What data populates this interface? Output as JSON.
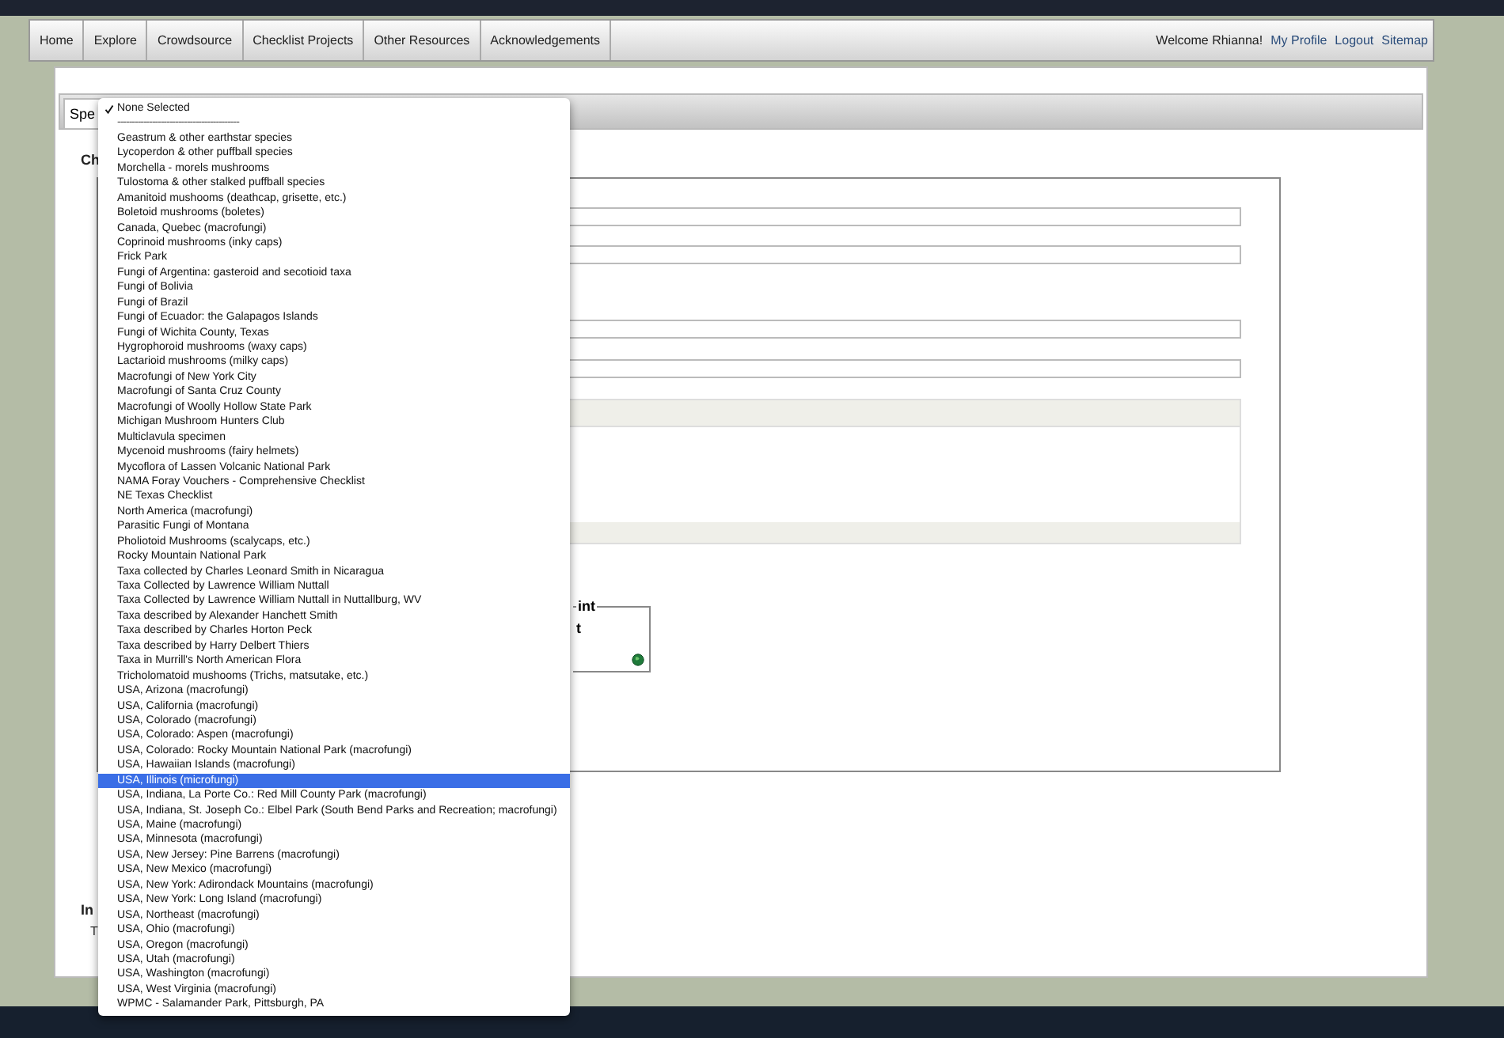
{
  "nav": {
    "links": [
      "Home",
      "Explore",
      "Crowdsource",
      "Checklist Projects",
      "Other Resources",
      "Acknowledgements"
    ],
    "welcome": "Welcome Rhianna!",
    "user_links": [
      "My Profile",
      "Logout",
      "Sitemap"
    ]
  },
  "tabs": [
    {
      "label": "Spe",
      "selected": true
    }
  ],
  "heading": "Ch",
  "footprint": {
    "legend": "int",
    "text": "t"
  },
  "section2": {
    "heading": "In",
    "text": "T"
  },
  "dropdown": {
    "options": [
      {
        "kind": "option",
        "label": "None Selected",
        "checked": true,
        "highlighted": false
      },
      {
        "kind": "separator",
        "label": "------------------------------------------"
      },
      {
        "kind": "option",
        "label": "Geastrum & other earthstar species",
        "checked": false,
        "highlighted": false
      },
      {
        "kind": "option",
        "label": "Lycoperdon & other puffball species",
        "checked": false,
        "highlighted": false
      },
      {
        "kind": "option",
        "label": "Morchella - morels mushrooms",
        "checked": false,
        "highlighted": false
      },
      {
        "kind": "option",
        "label": "Tulostoma & other stalked puffball species",
        "checked": false,
        "highlighted": false
      },
      {
        "kind": "option",
        "label": "Amanitoid mushooms (deathcap, grisette, etc.)",
        "checked": false,
        "highlighted": false
      },
      {
        "kind": "option",
        "label": "Boletoid mushrooms (boletes)",
        "checked": false,
        "highlighted": false
      },
      {
        "kind": "option",
        "label": "Canada, Quebec (macrofungi)",
        "checked": false,
        "highlighted": false
      },
      {
        "kind": "option",
        "label": "Coprinoid mushrooms (inky caps)",
        "checked": false,
        "highlighted": false
      },
      {
        "kind": "option",
        "label": "Frick Park",
        "checked": false,
        "highlighted": false
      },
      {
        "kind": "option",
        "label": "Fungi of Argentina: gasteroid and secotioid taxa",
        "checked": false,
        "highlighted": false
      },
      {
        "kind": "option",
        "label": "Fungi of Bolivia",
        "checked": false,
        "highlighted": false
      },
      {
        "kind": "option",
        "label": "Fungi of Brazil",
        "checked": false,
        "highlighted": false
      },
      {
        "kind": "option",
        "label": "Fungi of Ecuador: the Galapagos Islands",
        "checked": false,
        "highlighted": false
      },
      {
        "kind": "option",
        "label": "Fungi of Wichita County, Texas",
        "checked": false,
        "highlighted": false
      },
      {
        "kind": "option",
        "label": "Hygrophoroid mushrooms (waxy caps)",
        "checked": false,
        "highlighted": false
      },
      {
        "kind": "option",
        "label": "Lactarioid mushrooms (milky caps)",
        "checked": false,
        "highlighted": false
      },
      {
        "kind": "option",
        "label": "Macrofungi of New York City",
        "checked": false,
        "highlighted": false
      },
      {
        "kind": "option",
        "label": "Macrofungi of Santa Cruz County",
        "checked": false,
        "highlighted": false
      },
      {
        "kind": "option",
        "label": "Macrofungi of Woolly Hollow State Park",
        "checked": false,
        "highlighted": false
      },
      {
        "kind": "option",
        "label": "Michigan Mushroom Hunters Club",
        "checked": false,
        "highlighted": false
      },
      {
        "kind": "option",
        "label": "Multiclavula specimen",
        "checked": false,
        "highlighted": false
      },
      {
        "kind": "option",
        "label": "Mycenoid mushrooms (fairy helmets)",
        "checked": false,
        "highlighted": false
      },
      {
        "kind": "option",
        "label": "Mycoflora of Lassen Volcanic National Park",
        "checked": false,
        "highlighted": false
      },
      {
        "kind": "option",
        "label": "NAMA Foray Vouchers - Comprehensive Checklist",
        "checked": false,
        "highlighted": false
      },
      {
        "kind": "option",
        "label": "NE Texas Checklist",
        "checked": false,
        "highlighted": false
      },
      {
        "kind": "option",
        "label": "North America (macrofungi)",
        "checked": false,
        "highlighted": false
      },
      {
        "kind": "option",
        "label": "Parasitic Fungi of Montana",
        "checked": false,
        "highlighted": false
      },
      {
        "kind": "option",
        "label": "Pholiotoid Mushrooms (scalycaps, etc.)",
        "checked": false,
        "highlighted": false
      },
      {
        "kind": "option",
        "label": "Rocky Mountain National Park",
        "checked": false,
        "highlighted": false
      },
      {
        "kind": "option",
        "label": "Taxa collected by Charles Leonard Smith in Nicaragua",
        "checked": false,
        "highlighted": false
      },
      {
        "kind": "option",
        "label": "Taxa Collected by Lawrence William Nuttall",
        "checked": false,
        "highlighted": false
      },
      {
        "kind": "option",
        "label": "Taxa Collected by Lawrence William Nuttall in Nuttallburg, WV",
        "checked": false,
        "highlighted": false
      },
      {
        "kind": "option",
        "label": "Taxa described by Alexander Hanchett Smith",
        "checked": false,
        "highlighted": false
      },
      {
        "kind": "option",
        "label": "Taxa described by Charles Horton Peck",
        "checked": false,
        "highlighted": false
      },
      {
        "kind": "option",
        "label": "Taxa described by Harry Delbert Thiers",
        "checked": false,
        "highlighted": false
      },
      {
        "kind": "option",
        "label": "Taxa in Murrill's North American Flora",
        "checked": false,
        "highlighted": false
      },
      {
        "kind": "option",
        "label": "Tricholomatoid mushooms (Trichs, matsutake, etc.)",
        "checked": false,
        "highlighted": false
      },
      {
        "kind": "option",
        "label": "USA, Arizona (macrofungi)",
        "checked": false,
        "highlighted": false
      },
      {
        "kind": "option",
        "label": "USA, California (macrofungi)",
        "checked": false,
        "highlighted": false
      },
      {
        "kind": "option",
        "label": "USA, Colorado (macrofungi)",
        "checked": false,
        "highlighted": false
      },
      {
        "kind": "option",
        "label": "USA, Colorado: Aspen (macrofungi)",
        "checked": false,
        "highlighted": false
      },
      {
        "kind": "option",
        "label": "USA, Colorado: Rocky Mountain National Park (macrofungi)",
        "checked": false,
        "highlighted": false
      },
      {
        "kind": "option",
        "label": "USA, Hawaiian Islands (macrofungi)",
        "checked": false,
        "highlighted": false
      },
      {
        "kind": "option",
        "label": "USA, Illinois (microfungi)",
        "checked": false,
        "highlighted": true
      },
      {
        "kind": "option",
        "label": "USA, Indiana, La Porte Co.: Red Mill County Park (macrofungi)",
        "checked": false,
        "highlighted": false
      },
      {
        "kind": "option",
        "label": "USA, Indiana, St. Joseph Co.: Elbel Park (South Bend Parks and Recreation; macrofungi)",
        "checked": false,
        "highlighted": false
      },
      {
        "kind": "option",
        "label": "USA, Maine (macrofungi)",
        "checked": false,
        "highlighted": false
      },
      {
        "kind": "option",
        "label": "USA, Minnesota (macrofungi)",
        "checked": false,
        "highlighted": false
      },
      {
        "kind": "option",
        "label": "USA, New Jersey: Pine Barrens (macrofungi)",
        "checked": false,
        "highlighted": false
      },
      {
        "kind": "option",
        "label": "USA, New Mexico (macrofungi)",
        "checked": false,
        "highlighted": false
      },
      {
        "kind": "option",
        "label": "USA, New York: Adirondack Mountains (macrofungi)",
        "checked": false,
        "highlighted": false
      },
      {
        "kind": "option",
        "label": "USA, New York: Long Island (macrofungi)",
        "checked": false,
        "highlighted": false
      },
      {
        "kind": "option",
        "label": "USA, Northeast (macrofungi)",
        "checked": false,
        "highlighted": false
      },
      {
        "kind": "option",
        "label": "USA, Ohio (macrofungi)",
        "checked": false,
        "highlighted": false
      },
      {
        "kind": "option",
        "label": "USA, Oregon (macrofungi)",
        "checked": false,
        "highlighted": false
      },
      {
        "kind": "option",
        "label": "USA, Utah (macrofungi)",
        "checked": false,
        "highlighted": false
      },
      {
        "kind": "option",
        "label": "USA, Washington (macrofungi)",
        "checked": false,
        "highlighted": false
      },
      {
        "kind": "option",
        "label": "USA, West Virginia (macrofungi)",
        "checked": false,
        "highlighted": false
      },
      {
        "kind": "option",
        "label": "WPMC - Salamander Park, Pittsburgh, PA",
        "checked": false,
        "highlighted": false
      }
    ]
  }
}
